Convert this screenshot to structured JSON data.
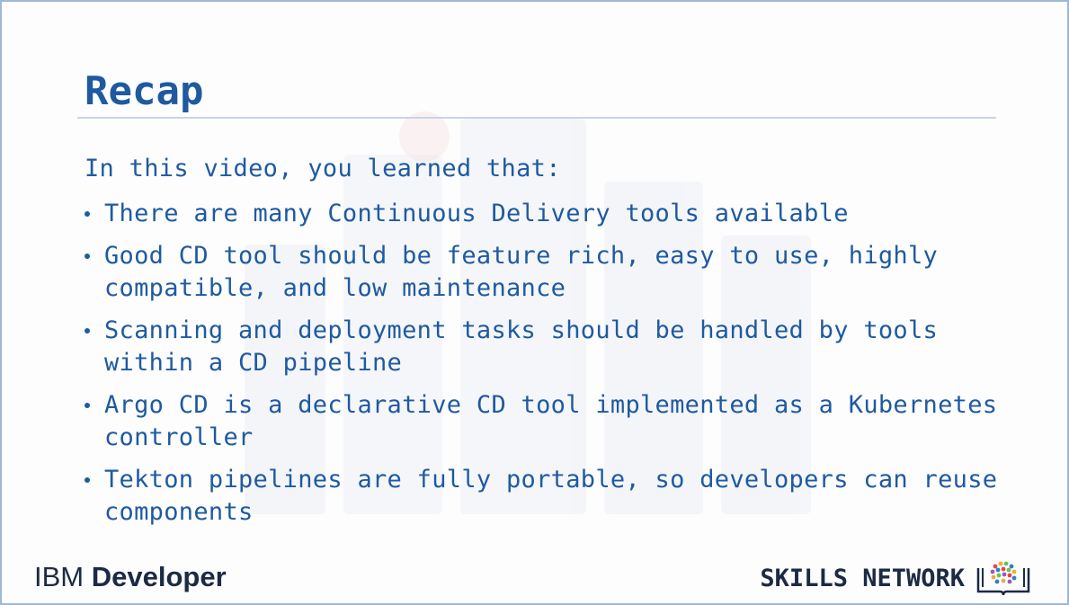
{
  "slide": {
    "title": "Recap",
    "intro": "In this video, you learned that:",
    "bullets": [
      "There are many Continuous Delivery tools available",
      "Good CD tool should be feature rich, easy to use, highly compatible, and low maintenance",
      "Scanning and deployment tasks should be handled by tools within a CD pipeline",
      "Argo CD is a declarative CD tool implemented as a Kubernetes controller",
      "Tekton pipelines are fully portable, so developers can reuse components"
    ]
  },
  "footer": {
    "brand": "IBM",
    "product": "Developer",
    "skills_network": "SKILLS NETWORK"
  },
  "colors": {
    "accent": "#1f5aa0",
    "footer_text": "#1c2a44",
    "border": "#9fb7d8"
  },
  "icons": {
    "skills_network_logo": "skills-network-logo-icon"
  }
}
